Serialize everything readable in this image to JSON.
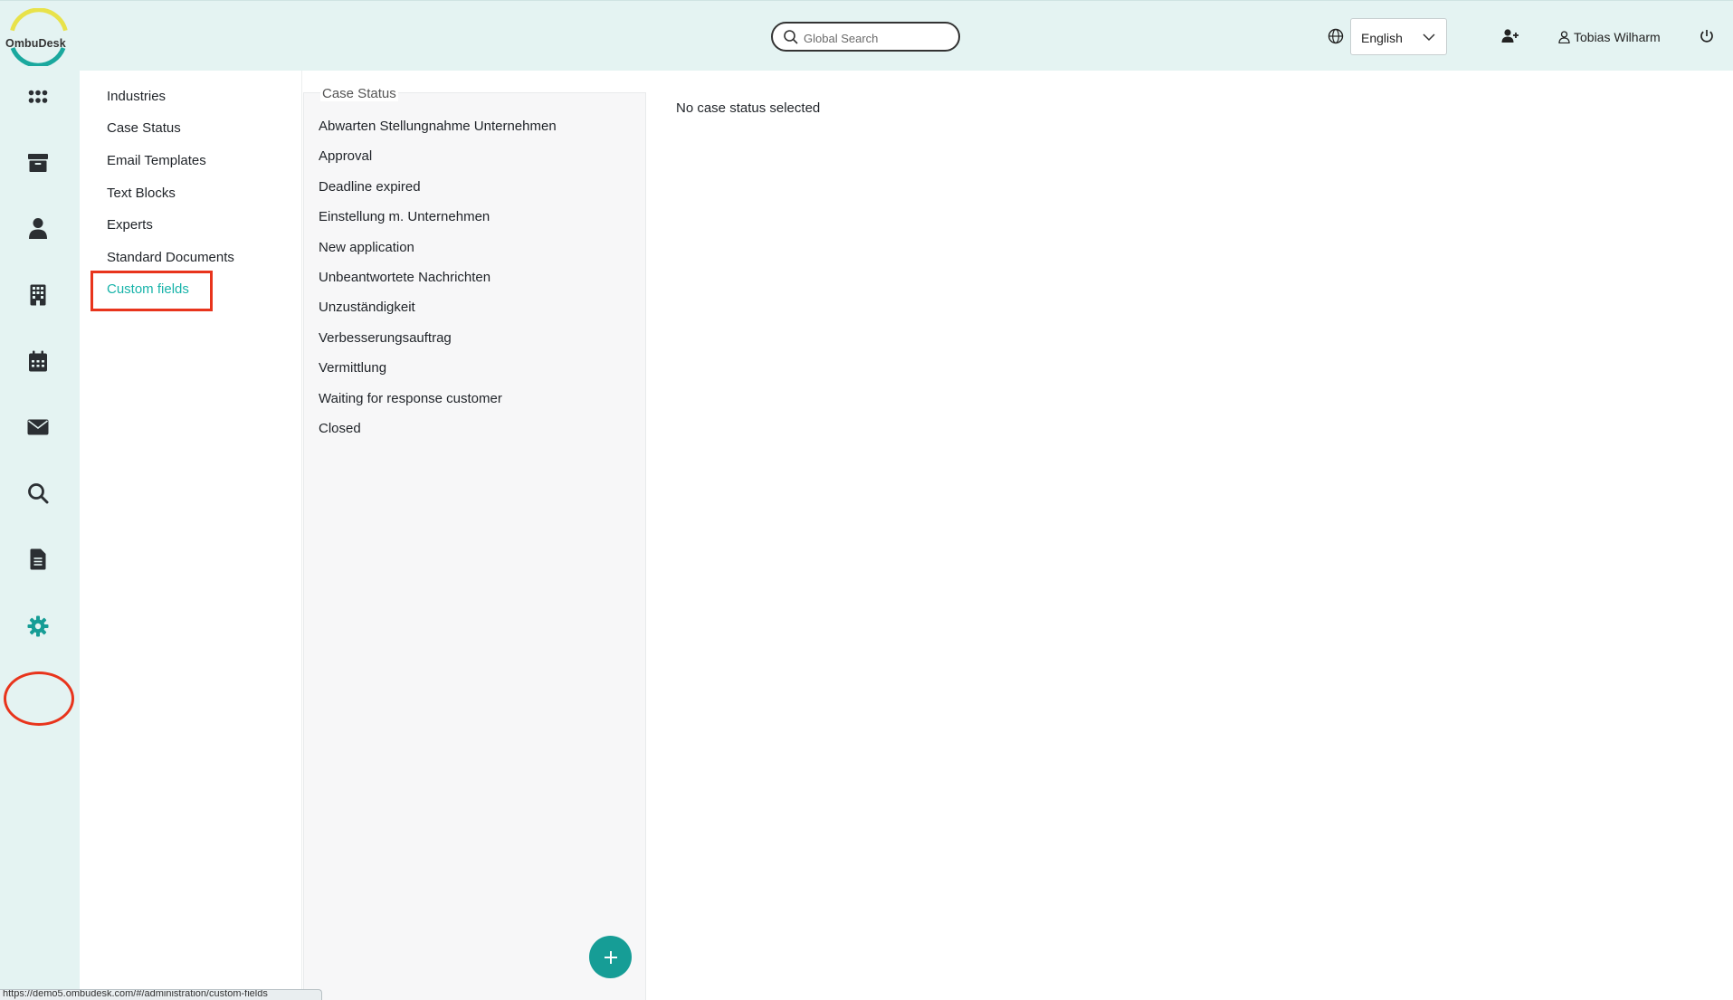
{
  "app": {
    "logo_text": "OmbuDesk"
  },
  "header": {
    "search_placeholder": "Global Search",
    "language": "English",
    "user_name": "Tobias Wilharm"
  },
  "rail": {
    "icons": [
      "apps-grid-icon",
      "archive-icon",
      "person-icon",
      "building-icon",
      "calendar-icon",
      "envelope-icon",
      "search-icon",
      "document-icon",
      "gear-icon"
    ],
    "active": "gear-icon",
    "accent": "#169d96"
  },
  "admin_nav": {
    "items": [
      "Industries",
      "Case Status",
      "Email Templates",
      "Text Blocks",
      "Experts",
      "Standard Documents",
      "Custom fields"
    ],
    "active": "Custom fields"
  },
  "case_status": {
    "title": "Case Status",
    "items": [
      "Abwarten Stellungnahme Unternehmen",
      "Approval",
      "Deadline expired",
      "Einstellung m. Unternehmen",
      "New application",
      "Unbeantwortete Nachrichten",
      "Unzuständigkeit",
      "Verbesserungsauftrag",
      "Vermittlung",
      "Waiting for response customer",
      "Closed"
    ]
  },
  "detail": {
    "empty_text": "No case status selected"
  },
  "status_bar": {
    "url": "https://demo5.ombudesk.com/#/administration/custom-fields"
  },
  "colors": {
    "teal": "#17b3a9",
    "highlight_red": "#e8341c",
    "sidebar_bg": "#e4f3f2"
  }
}
